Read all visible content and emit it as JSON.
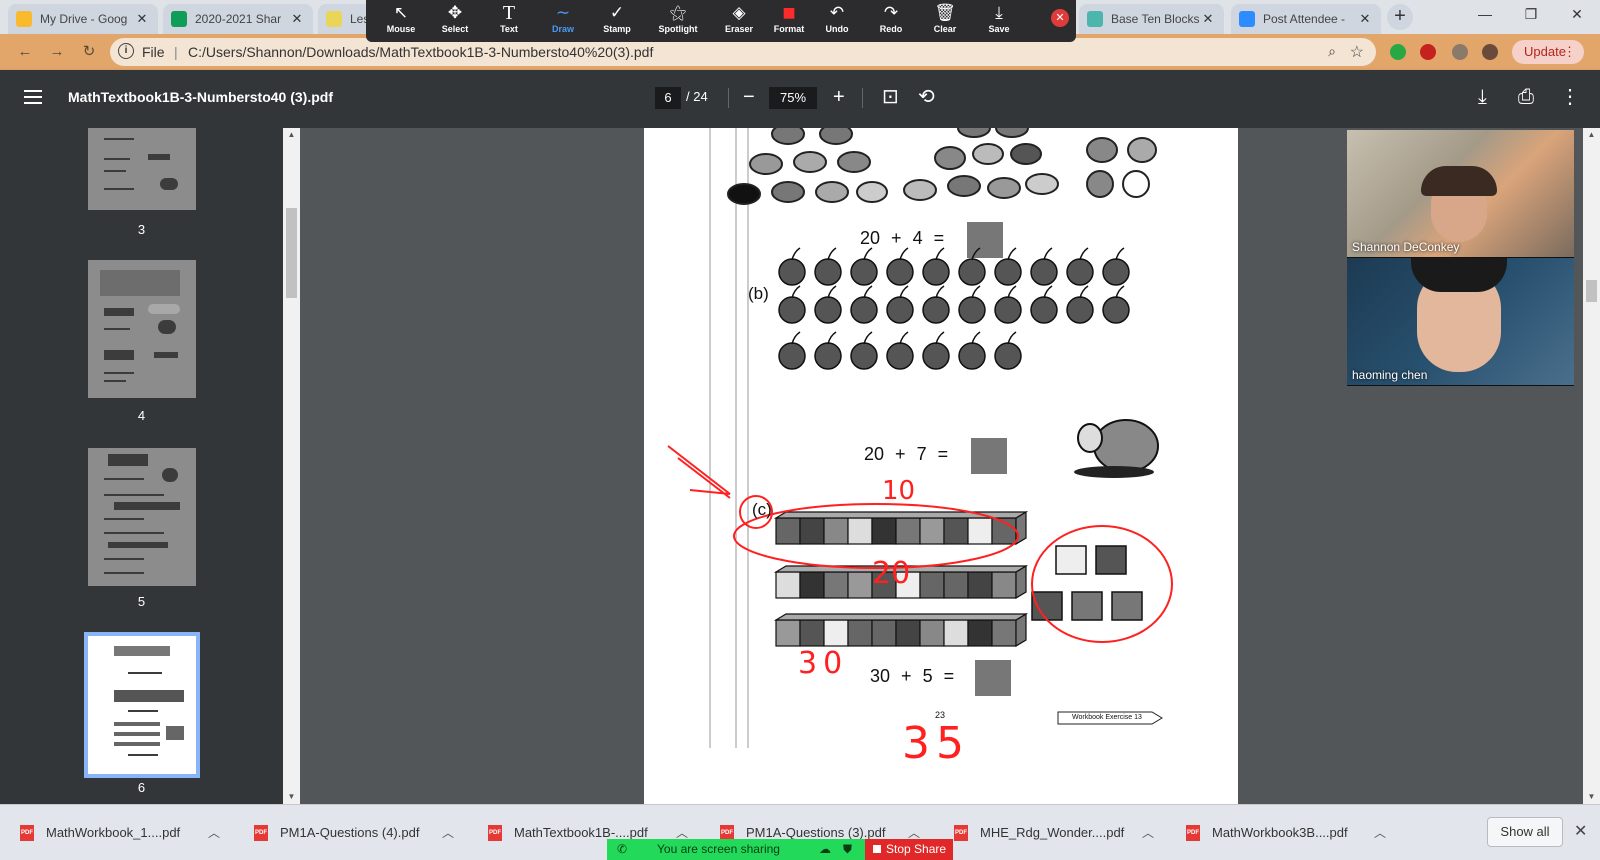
{
  "browser": {
    "tabs": [
      {
        "title": "My Drive - Goog",
        "color": "#f9bb2d"
      },
      {
        "title": "2020-2021 Shar",
        "color": "#0f9d58"
      },
      {
        "title": "Les",
        "color": "#e8d55a"
      },
      {
        "title": "Base Ten Blocks",
        "color": "#4db6ac"
      },
      {
        "title": "Post Attendee -",
        "color": "#2d8cff"
      }
    ],
    "close_glyph": "✕",
    "new_tab_glyph": "+",
    "window_controls": [
      "—",
      "❐",
      "✕"
    ],
    "nav_glyphs": [
      "←",
      "→",
      "↻"
    ]
  },
  "annotate_toolbar": {
    "tools": [
      {
        "label": "Mouse",
        "icon": "↖"
      },
      {
        "label": "Select",
        "icon": "✥"
      },
      {
        "label": "Text",
        "icon": "T"
      },
      {
        "label": "Draw",
        "icon": "∼",
        "active": true
      },
      {
        "label": "Stamp",
        "icon": "✓"
      },
      {
        "label": "Spotlight",
        "icon": "⚝"
      },
      {
        "label": "Eraser",
        "icon": "◈"
      },
      {
        "label": "Format",
        "icon": "■"
      },
      {
        "label": "Undo",
        "icon": "↶"
      },
      {
        "label": "Redo",
        "icon": "↷"
      },
      {
        "label": "Clear",
        "icon": "🗑"
      },
      {
        "label": "Save",
        "icon": "⤓"
      }
    ],
    "format_color": "#ff2b2b",
    "close_glyph": "✕"
  },
  "address_bar": {
    "protocol": "File",
    "url": "C:/Users/Shannon/Downloads/MathTextbook1B-3-Numbersto40%20(3).pdf",
    "info_glyph": "i",
    "zoom_glyph": "⌕",
    "star_glyph": "☆",
    "update_label": "Update",
    "more_glyph": "⋮"
  },
  "pdf_viewer": {
    "title": "MathTextbook1B-3-Numbersto40 (3).pdf",
    "current_page": "6",
    "total_pages": "/ 24",
    "zoom": "75%",
    "zoom_out_glyph": "−",
    "zoom_in_glyph": "+",
    "fit_glyph": "⊡",
    "rotate_glyph": "⟲",
    "download_glyph": "⤓",
    "print_glyph": "⎙",
    "more_glyph": "⋮"
  },
  "sidebar": {
    "thumbnails": [
      {
        "number": "3"
      },
      {
        "number": "4"
      },
      {
        "number": "5"
      },
      {
        "number": "6",
        "selected": true
      }
    ]
  },
  "page_content": {
    "eq_a": {
      "a": "20",
      "op": "+",
      "b": "4",
      "eq": "="
    },
    "label_b": "(b)",
    "eq_b": {
      "a": "20",
      "op": "+",
      "b": "7",
      "eq": "="
    },
    "label_c": "(c)",
    "eq_c": {
      "a": "30",
      "op": "+",
      "b": "5",
      "eq": "="
    },
    "page_number": "23",
    "workbook_ref": "Workbook Exercise 13",
    "annotations": {
      "ten": "10",
      "twenty": "20",
      "thirty": "30",
      "answer": "35",
      "color": "#ff2020"
    }
  },
  "video": {
    "participants": [
      {
        "name": "Shannon DeConkey"
      },
      {
        "name": "haoming chen"
      }
    ]
  },
  "downloads": {
    "items": [
      {
        "name": "MathWorkbook_1....pdf"
      },
      {
        "name": "PM1A-Questions (4).pdf"
      },
      {
        "name": "MathTextbook1B-....pdf"
      },
      {
        "name": "PM1A-Questions (3).pdf"
      },
      {
        "name": "MHE_Rdg_Wonder....pdf"
      },
      {
        "name": "MathWorkbook3B....pdf"
      }
    ],
    "pdf_badge": "PDF",
    "chevron_glyph": "︿",
    "show_all_label": "Show all",
    "close_glyph": "✕"
  },
  "share": {
    "status": "You are screen sharing",
    "stop_label": "Stop Share",
    "phone_glyph": "✆",
    "shield_glyph": "⛊",
    "cloud_glyph": "☁"
  }
}
